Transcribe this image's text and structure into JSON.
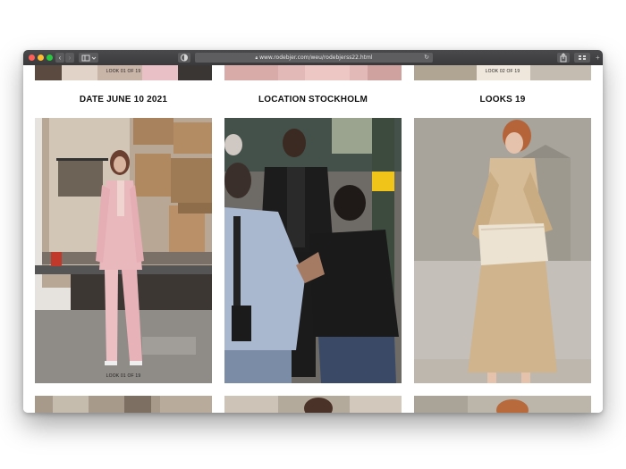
{
  "browser": {
    "url": "www.rodebjer.com/weu/rodebjerss22.html",
    "lock_icon": "lock-icon",
    "reload_icon": "reload-icon"
  },
  "top_strip": {
    "left_label": "LOOK 01 OF 19",
    "right_label": "LOOK 02 OF 19"
  },
  "headings": {
    "date": "DATE JUNE 10 2021",
    "location": "LOCATION STOCKHOLM",
    "looks": "LOOKS 19"
  },
  "gallery": {
    "first_look_label": "LOOK 01 OF 19"
  },
  "colors": {
    "toolbar": "#3c3c3e",
    "page_background": "#ffffff",
    "heading_text": "#111111"
  }
}
